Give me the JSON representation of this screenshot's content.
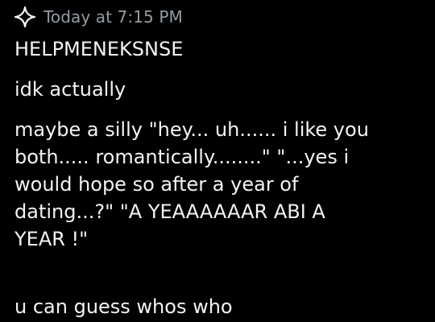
{
  "header": {
    "icon": "sparkle-icon",
    "timestamp": "Today at 7:15 PM"
  },
  "messages": [
    {
      "text": "HELPMENEKSNSE"
    },
    {
      "text": "idk actually"
    },
    {
      "lines": [
        "maybe a silly \"hey... uh...... i like you",
        "both..... romantically........\" \"...yes i",
        "would hope so after a year of",
        "dating...?\" \"A YEAAAAAAR ABI A",
        "YEAR !\""
      ]
    },
    {
      "text": "u can guess whos who"
    }
  ],
  "colors": {
    "background": "#000000",
    "text": "#f2f3f5",
    "timestamp": "#949ba4"
  }
}
